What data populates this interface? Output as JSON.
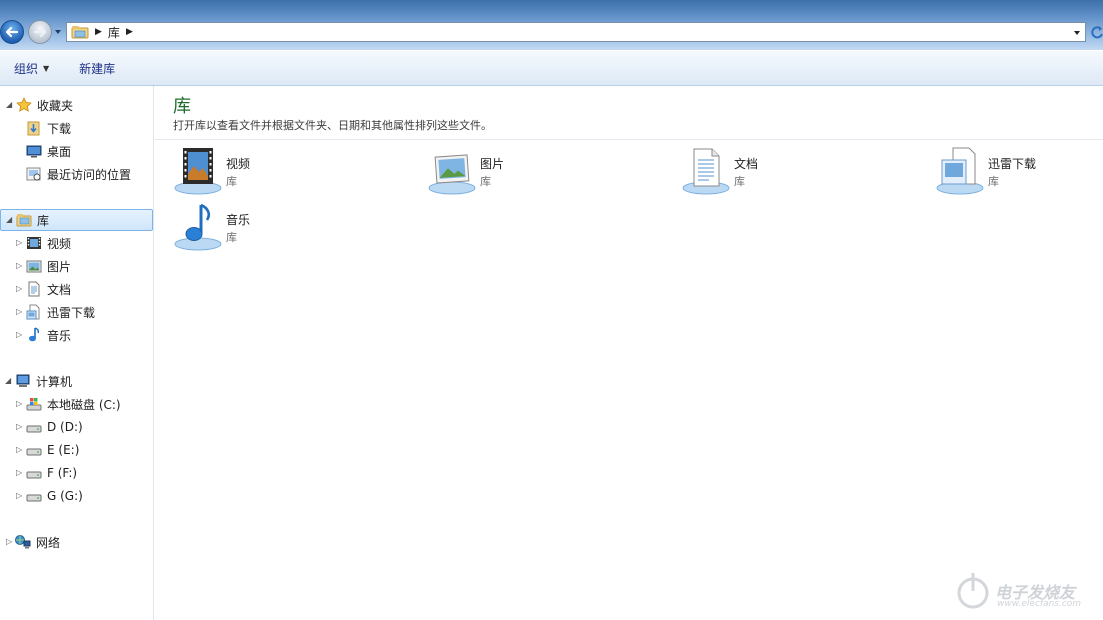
{
  "address": {
    "crumb": "库"
  },
  "toolbar": {
    "organize": "组织",
    "new_library": "新建库"
  },
  "sidebar": {
    "favorites": {
      "label": "收藏夹",
      "items": [
        "下载",
        "桌面",
        "最近访问的位置"
      ]
    },
    "libraries": {
      "label": "库",
      "items": [
        "视频",
        "图片",
        "文档",
        "迅雷下载",
        "音乐"
      ]
    },
    "computer": {
      "label": "计算机",
      "items": [
        "本地磁盘 (C:)",
        "D (D:)",
        "E (E:)",
        "F (F:)",
        "G (G:)"
      ]
    },
    "network": {
      "label": "网络"
    }
  },
  "main": {
    "title": "库",
    "subtitle": "打开库以查看文件并根据文件夹、日期和其他属性排列这些文件。",
    "libraries": [
      {
        "name": "视频",
        "type": "库",
        "icon": "video-library-icon"
      },
      {
        "name": "图片",
        "type": "库",
        "icon": "pictures-library-icon"
      },
      {
        "name": "文档",
        "type": "库",
        "icon": "documents-library-icon"
      },
      {
        "name": "迅雷下载",
        "type": "库",
        "icon": "xunlei-library-icon"
      },
      {
        "name": "音乐",
        "type": "库",
        "icon": "music-library-icon"
      }
    ]
  },
  "watermark": {
    "text": "电子发烧友",
    "sub": "www.elecfans.com"
  },
  "colors": {
    "title_green": "#1e6b2e",
    "selection": "#cfe6fc",
    "toolbar_text": "#1e3287"
  }
}
